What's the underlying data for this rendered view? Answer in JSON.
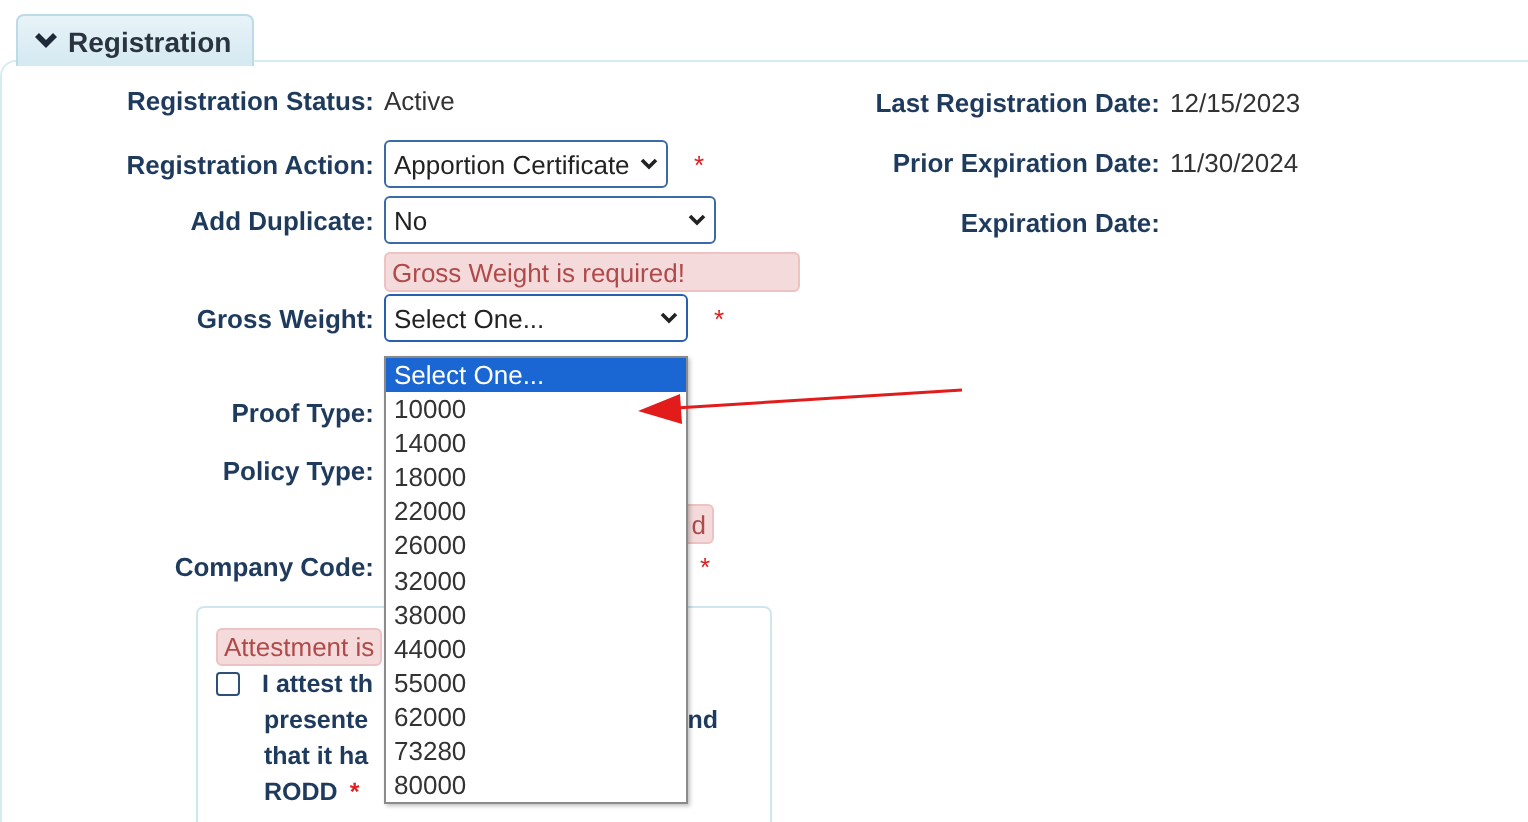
{
  "section_tab": {
    "label": "Registration",
    "expanded": true
  },
  "left_fields": [
    {
      "kind": "text",
      "label": "Registration Status:",
      "value": "Active"
    },
    {
      "kind": "select",
      "label": "Registration Action:",
      "value": "Apportion Certificate",
      "required_mark": "*"
    },
    {
      "kind": "select",
      "label": "Add Duplicate:",
      "value": "No"
    },
    {
      "kind": "error",
      "message": "Gross Weight is required!"
    },
    {
      "kind": "select",
      "label": "Gross Weight:",
      "value": "Select One...",
      "required_mark": "*",
      "expanded": true
    },
    {
      "kind": "covered",
      "label": "Proof Type:"
    },
    {
      "kind": "covered",
      "label": "Policy Type:"
    },
    {
      "kind": "error",
      "message": "d"
    },
    {
      "kind": "covered",
      "label": "Company Code:",
      "required_mark": "*"
    }
  ],
  "gross_weight_options": [
    {
      "label": "Select One...",
      "selected": true
    },
    {
      "label": "10000",
      "selected": false
    },
    {
      "label": "14000",
      "selected": false
    },
    {
      "label": "18000",
      "selected": false
    },
    {
      "label": "22000",
      "selected": false
    },
    {
      "label": "26000",
      "selected": false
    },
    {
      "label": "32000",
      "selected": false
    },
    {
      "label": "38000",
      "selected": false
    },
    {
      "label": "44000",
      "selected": false
    },
    {
      "label": "55000",
      "selected": false
    },
    {
      "label": "62000",
      "selected": false
    },
    {
      "label": "73280",
      "selected": false
    },
    {
      "label": "80000",
      "selected": false
    }
  ],
  "right_fields": [
    {
      "label": "Last Registration Date:",
      "value": "12/15/2023"
    },
    {
      "label": "Prior Expiration Date:",
      "value": "11/30/2024"
    },
    {
      "label": "Expiration Date:"
    }
  ],
  "attestation": {
    "error": "Attestment is",
    "checked": false,
    "lines": [
      {
        "left": "I attest th"
      },
      {
        "left": "presente",
        "right": "nd"
      },
      {
        "left": "that it ha"
      },
      {
        "left": "RODD",
        "required_mark": "*"
      }
    ]
  }
}
